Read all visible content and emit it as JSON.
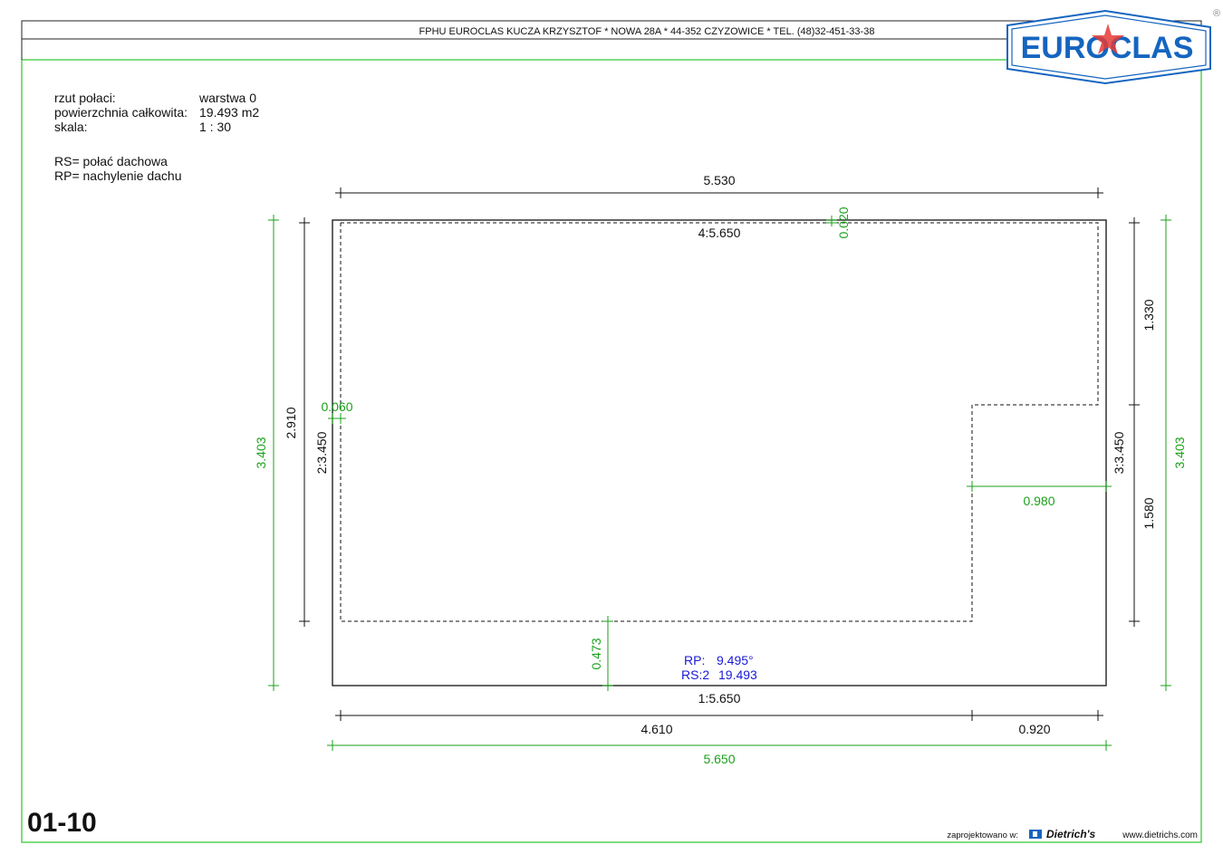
{
  "header": {
    "company_line": "FPHU EUROCLAS KUCZA KRZYSZTOF * NOWA 28A * 44-352 CZYZOWICE * TEL. (48)32-451-33-38",
    "logo_text": "EUROCLAS",
    "registered_mark": "®"
  },
  "info": {
    "rzut_label": "rzut połaci:",
    "rzut_value": "warstwa 0",
    "area_label": "powierzchnia całkowita:",
    "area_value": "19.493 m2",
    "scale_label": "skala:",
    "scale_value": "1 : 30",
    "legend_rs": "RS= połać dachowa",
    "legend_rp": "RP= nachylenie dachu"
  },
  "dimensions": {
    "top_width": "5.530",
    "top_edge": "4:5.650",
    "top_offset": "0.020",
    "left_outer": "3.403",
    "left_inner": "2.910",
    "left_edge": "2:3.450",
    "left_offset": "0.060",
    "right_upper": "1.330",
    "right_lower": "1.580",
    "right_edge": "3:3.450",
    "right_outer": "3.403",
    "notch_width": "0.980",
    "bottom_offset": "0.473",
    "bottom_edge": "1:5.650",
    "bottom_left_segment": "4.610",
    "bottom_right_segment": "0.920",
    "bottom_total": "5.650"
  },
  "panel": {
    "rp_label": "RP:",
    "rp_value": "9.495°",
    "rs_label": "RS:2",
    "rs_value": "19.493"
  },
  "footer": {
    "sheet_number": "01-10",
    "designed_in": "zaprojektowano w:",
    "software_name": "Dietrich's",
    "website": "www.dietrichs.com"
  },
  "colors": {
    "dimension_green": "#1aa01a",
    "label_blue": "#1a1ad6",
    "logo_blue": "#1565c0",
    "logo_red": "#e53935"
  }
}
